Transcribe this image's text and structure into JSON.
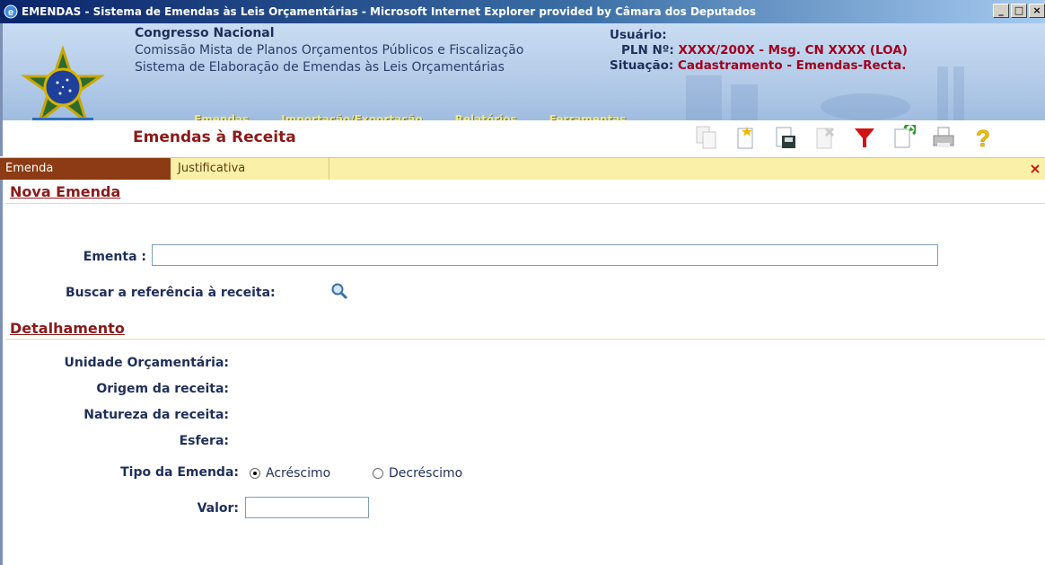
{
  "window": {
    "title": "EMENDAS - Sistema de Emendas às Leis Orçamentárias - Microsoft Internet Explorer provided by Câmara dos Deputados",
    "min": "_",
    "max": "□",
    "close": "×"
  },
  "header": {
    "org_line1": "Congresso Nacional",
    "org_line2": "Comissão Mista de Planos Orçamentos Públicos e Fiscalização",
    "org_line3": "Sistema de Elaboração de Emendas às Leis Orçamentárias",
    "user_label": "Usuário:",
    "pln_label": "PLN Nº:",
    "pln_value": "XXXX/200X - Msg. CN XXXX (LOA)",
    "situacao_label": "Situação:",
    "situacao_value": "Cadastramento - Emendas-Recta."
  },
  "menu": [
    "Emendas",
    "Importação/Exportação",
    "Relatórios",
    "Ferramentas"
  ],
  "page_title": "Emendas à Receita",
  "toolbar_icons": [
    "copy-icon",
    "new-icon",
    "save-icon",
    "delete-icon",
    "filter-icon",
    "refresh-icon",
    "print-icon",
    "help-icon"
  ],
  "tabs": {
    "active": "Emenda",
    "other": "Justificativa",
    "close": "×"
  },
  "form": {
    "section1": "Nova Emenda",
    "ementa_label": "Ementa :",
    "ementa_value": "",
    "buscar_label": "Buscar a referência à receita:",
    "section2": "Detalhamento",
    "unidade_label": "Unidade Orçamentária:",
    "origem_label": "Origem da receita:",
    "natureza_label": "Natureza da receita:",
    "esfera_label": "Esfera:",
    "tipo_label": "Tipo da Emenda:",
    "tipo_opt1": "Acréscimo",
    "tipo_opt2": "Decréscimo",
    "tipo_selected": "Acréscimo",
    "valor_label": "Valor:",
    "valor_value": ""
  }
}
